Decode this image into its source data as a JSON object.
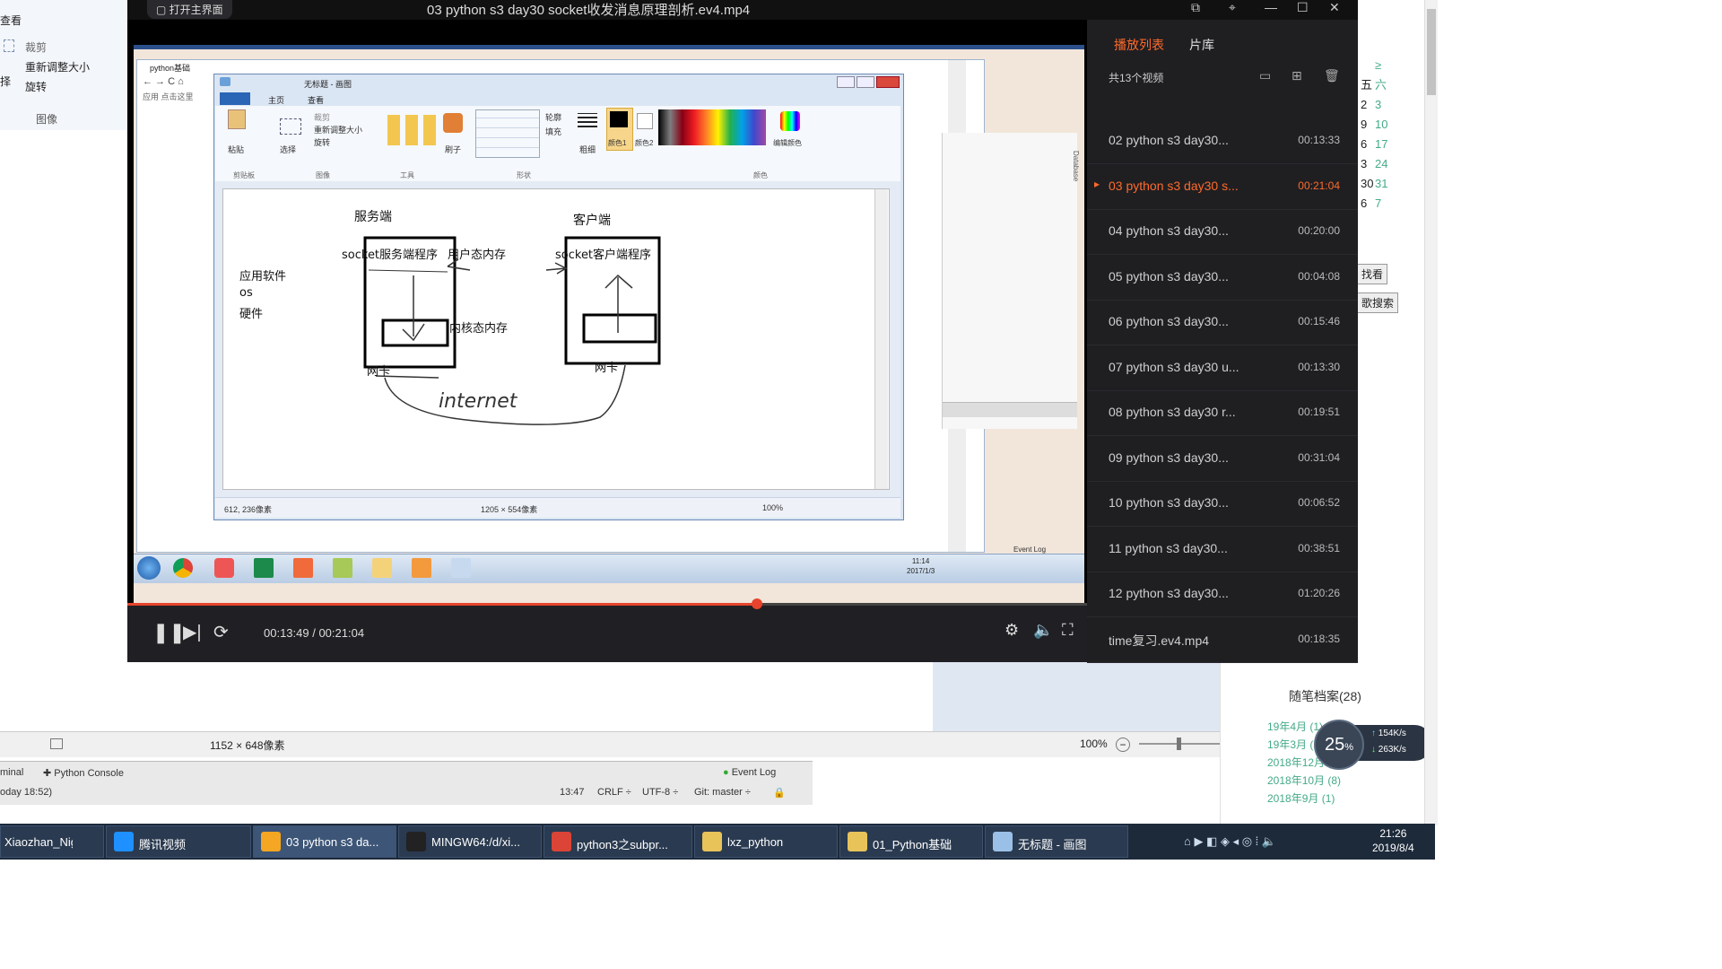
{
  "colors": {
    "accent": "#ff6a2a",
    "progress": "#e8432c",
    "player_bg": "#1c1c1f",
    "taskbar": "#1d2a3a"
  },
  "background_window": {
    "menu_label": "查看",
    "crop_label": "裁剪",
    "resize_label": "重新调整大小",
    "rotate_label": "旋转",
    "select_label": "择",
    "group_label": "图像",
    "status_size": "1152 × 648像素",
    "zoom": "100%"
  },
  "ide": {
    "terminal_tab": "minal",
    "console_tab": "Python Console",
    "event_log": "Event Log",
    "time_text": "oday 18:52)",
    "cursor": "13:47",
    "line_sep": "CRLF ÷",
    "encoding": "UTF-8 ÷",
    "branch": "Git: master ÷"
  },
  "blog": {
    "calendar_header": [
      "≥",
      "六"
    ],
    "calendar_rows": [
      [
        "五",
        "六"
      ],
      [
        "2",
        "3"
      ],
      [
        "9",
        "10"
      ],
      [
        "6",
        "17"
      ],
      [
        "3",
        "24"
      ],
      [
        "30",
        "31"
      ],
      [
        "6",
        "7"
      ]
    ],
    "btn_find": "找看",
    "btn_search": "歌搜索",
    "archive_title": "随笔档案(28)",
    "archive_items": [
      "19年4月 (1)",
      "19年3月 (1)",
      "2018年12月 (2)",
      "2018年10月 (8)",
      "2018年9月 (1)"
    ],
    "meter_percent": "25",
    "meter_unit": "%",
    "net_up": "154K/s",
    "net_down": "263K/s"
  },
  "player": {
    "title": "03 python s3 day30 socket收发消息原理剖析.ev4.mp4",
    "back_button": "打开主界面",
    "current_time": "00:13:49",
    "total_time": "00:21:04",
    "progress": 0.656,
    "playlist_tabs": [
      "播放列表",
      "片库"
    ],
    "playlist_count": "共13个视频",
    "playlist_items": [
      {
        "title": "02 python s3 day30...",
        "duration": "00:13:33",
        "active": false
      },
      {
        "title": "03 python s3 day30 s...",
        "duration": "00:21:04",
        "active": true
      },
      {
        "title": "04 python s3 day30...",
        "duration": "00:20:00",
        "active": false
      },
      {
        "title": "05 python s3 day30...",
        "duration": "00:04:08",
        "active": false
      },
      {
        "title": "06 python s3 day30...",
        "duration": "00:15:46",
        "active": false
      },
      {
        "title": "07 python s3 day30 u...",
        "duration": "00:13:30",
        "active": false
      },
      {
        "title": "08 python s3 day30 r...",
        "duration": "00:19:51",
        "active": false
      },
      {
        "title": "09 python s3 day30...",
        "duration": "00:31:04",
        "active": false
      },
      {
        "title": "10 python s3 day30...",
        "duration": "00:06:52",
        "active": false
      },
      {
        "title": "11 python s3 day30...",
        "duration": "00:38:51",
        "active": false
      },
      {
        "title": "12 python s3 day30...",
        "duration": "01:20:26",
        "active": false
      },
      {
        "title": "time复习.ev4.mp4",
        "duration": "00:18:35",
        "active": false
      }
    ]
  },
  "video": {
    "browser_tab": "python基础",
    "browser_apps": "应用  点击这里",
    "paint_title": "无标题 - 画图",
    "ribbon_tabs": [
      "主页",
      "查看"
    ],
    "ribbon_groups": [
      "剪贴板",
      "图像",
      "工具",
      "形状",
      "颜色"
    ],
    "ribbon_buttons": {
      "paste": "粘贴",
      "select": "选择",
      "crop": "裁剪",
      "resize": "重新调整大小",
      "rotate": "旋转",
      "brush": "刷子",
      "size": "粗细",
      "color1": "颜色1",
      "color2": "颜色2",
      "edit_colors": "编辑颜色",
      "outline": "轮廓",
      "fill": "填充"
    },
    "canvas_text": {
      "server": "服务端",
      "client": "客户端",
      "server_prog": "socket服务端程序",
      "client_prog": "socket客户端程序",
      "user_mem": "用户态内存",
      "kernel_mem": "内核态内存",
      "app": "应用软件",
      "os": "os",
      "hw": "硬件",
      "nic_left": "网卡",
      "nic_right": "网卡",
      "internet": "internet"
    },
    "status_pos": "612, 236像素",
    "status_size": "1205 × 554像素",
    "zoom": "100%",
    "clock_time": "11:14",
    "clock_date": "2017/1/3",
    "event_log": "Event Log",
    "side_label": "Database"
  },
  "taskbar": {
    "items": [
      "Xiaozhan_Nightl...",
      "腾讯视频",
      "03 python s3 da...",
      "MINGW64:/d/xi...",
      "python3之subpr...",
      "lxz_python",
      "01_Python基础",
      "无标题 - 画图"
    ],
    "clock_time": "21:26",
    "clock_date": "2019/8/4"
  }
}
